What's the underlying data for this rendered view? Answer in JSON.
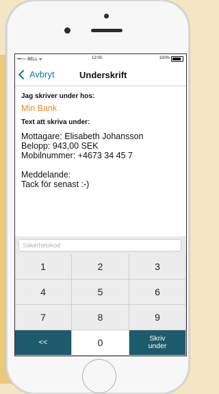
{
  "status_bar": {
    "carrier": "•••○○ BELL ᯤ",
    "time": "12:00",
    "battery": "100%"
  },
  "nav": {
    "back_label": "Avbryt",
    "title": "Underskrift"
  },
  "content": {
    "signing_at_label": "Jag skriver under hos:",
    "bank_name": "Min Bank",
    "text_label": "Text att skriva under:",
    "message_lines": [
      "Mottagare: Elisabeth Johansson",
      "Belopp: 943,00 SEK",
      "Mobilnummer: +4673 34 45 7"
    ],
    "message_heading": "Meddelande:",
    "message_text": "Tack för senast :-)"
  },
  "code_input": {
    "placeholder": "Säkerhetskod",
    "value": ""
  },
  "keypad": {
    "keys": [
      "1",
      "2",
      "3",
      "4",
      "5",
      "6",
      "7",
      "8",
      "9"
    ],
    "back_key": "<<",
    "zero_key": "0",
    "submit_line1": "Skriv",
    "submit_line2": "under"
  },
  "colors": {
    "accent_blue": "#0a7aa3",
    "bank_orange": "#f08a1c",
    "keypad_dark": "#1d5a6b",
    "background_tan": "#f4e6c4"
  }
}
